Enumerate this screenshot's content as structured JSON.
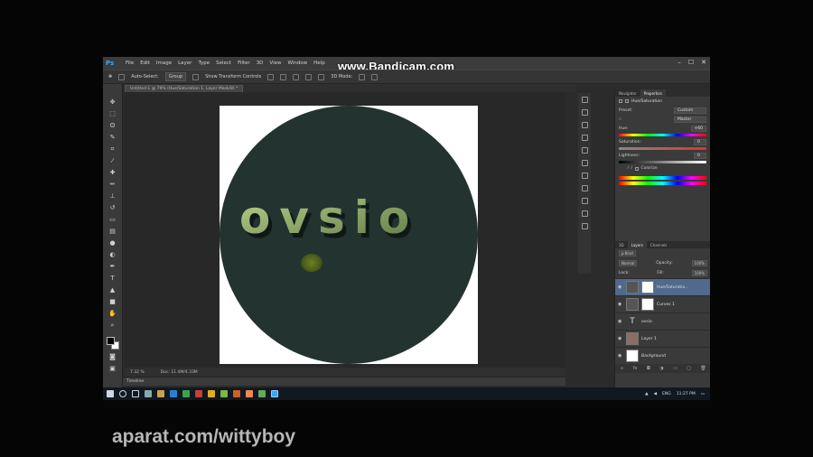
{
  "menubar": {
    "logo": "Ps",
    "items": [
      "File",
      "Edit",
      "Image",
      "Layer",
      "Type",
      "Select",
      "Filter",
      "3D",
      "View",
      "Window",
      "Help"
    ],
    "window_controls": [
      "–",
      "☐",
      "✕"
    ]
  },
  "options_bar": {
    "auto_select_label": "Auto-Select:",
    "auto_select_value": "Group",
    "transform_controls_label": "Show Transform Controls",
    "mode_label": "3D Mode:"
  },
  "document_tabs": [
    {
      "label": "Untitled-1 @ 79% (Hue/Saturation 1, Layer Mask/8) *"
    }
  ],
  "watermark_top": "www.Bandicam.com",
  "watermark_bottom": "aparat.com/wittyboy",
  "canvas_text": "ovsio",
  "colors": {
    "circle": "#223330",
    "text_fill_light": "#b9d28a",
    "text_fill_dark": "#5e7846",
    "text_shadow": "#0f1816"
  },
  "status_bar": {
    "zoom": "7.32 %",
    "doc": "Doc: 11.4M/4.33M"
  },
  "timeline_label": "Timeline",
  "properties_panel": {
    "tabs": [
      "Navigator",
      "Properties"
    ],
    "active_tab": "Properties",
    "title": "Hue/Saturation",
    "preset_label": "Preset:",
    "preset_value": "Custom",
    "channel_value": "Master",
    "hue_label": "Hue:",
    "hue_value": "+60",
    "saturation_label": "Saturation:",
    "saturation_value": "0",
    "lightness_label": "Lightness:",
    "lightness_value": "0",
    "colorize_label": "Colorize"
  },
  "layers_panel": {
    "tabs": [
      "3D",
      "Layers",
      "Channels"
    ],
    "active_tab": "Layers",
    "filter_label": "ρ Kind",
    "blend_mode": "Normal",
    "opacity_label": "Opacity:",
    "opacity_value": "100%",
    "lock_label": "Lock:",
    "fill_label": "Fill:",
    "fill_value": "100%",
    "layers": [
      {
        "name": "Hue/Saturatio...",
        "thumb": "adj",
        "selected": true
      },
      {
        "name": "Curves 1",
        "thumb": "adj",
        "selected": false
      },
      {
        "name": "ovsio",
        "thumb": "text",
        "selected": false
      },
      {
        "name": "Layer 1",
        "thumb": "photo",
        "selected": false
      },
      {
        "name": "Background",
        "thumb": "white",
        "selected": false
      }
    ]
  },
  "taskbar": {
    "lang": "ENG",
    "time": "11:27 PM"
  }
}
